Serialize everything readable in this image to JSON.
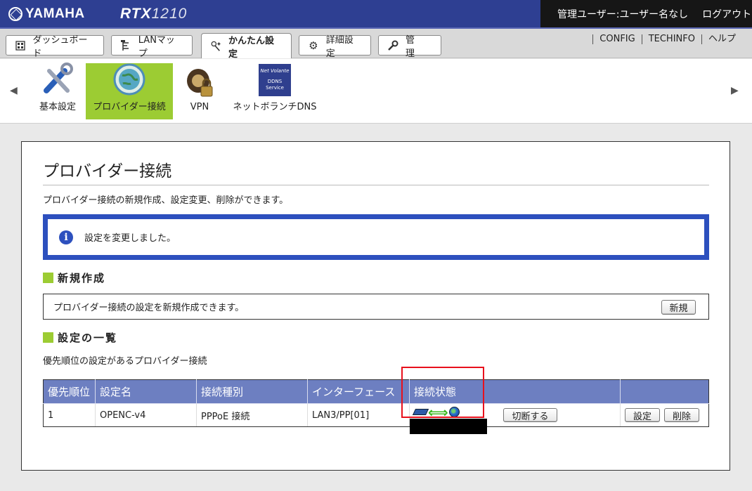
{
  "header": {
    "brand": "YAMAHA",
    "model_main": "RTX",
    "model_num": "1210",
    "user_label": "管理ユーザー:ユーザー名なし",
    "logout": "ログアウト"
  },
  "tabs": [
    {
      "label": "ダッシュボード",
      "icon": "dashboard-icon"
    },
    {
      "label": "LANマップ",
      "icon": "lan-map-icon"
    },
    {
      "label": "かんたん設定",
      "icon": "wand-icon"
    },
    {
      "label": "詳細設定",
      "icon": "gear-icon"
    },
    {
      "label": "管　理",
      "icon": "wrench-icon"
    }
  ],
  "right_links": [
    "CONFIG",
    "TECHINFO",
    "ヘルプ"
  ],
  "subnav": [
    {
      "label": "基本設定",
      "icon": "tools-icon"
    },
    {
      "label": "プロバイダー接続",
      "icon": "globe-icon"
    },
    {
      "label": "VPN",
      "icon": "vpn-icon"
    },
    {
      "label": "ネットボランチDNS",
      "icon": "ddns-icon",
      "icon_text": [
        "Net Volante",
        "DDNS",
        "Service"
      ]
    }
  ],
  "page": {
    "title": "プロバイダー接続",
    "description": "プロバイダー接続の新規作成、設定変更、削除ができます。",
    "notice": "設定を変更しました。",
    "new_section_title": "新規作成",
    "new_section_text": "プロバイダー接続の設定を新規作成できます。",
    "new_button": "新規",
    "list_section_title": "設定の一覧",
    "list_desc": "優先順位の設定があるプロバイダー接続"
  },
  "table": {
    "headers": [
      "優先順位",
      "設定名",
      "接続種別",
      "インターフェース",
      "接続状態",
      ""
    ],
    "rows": [
      {
        "priority": "1",
        "name": "OPENC-v4",
        "type": "PPPoE 接続",
        "interface": "LAN3/PP[01]",
        "disconnect_button": "切断する",
        "edit_button": "設定",
        "delete_button": "削除"
      }
    ]
  },
  "colors": {
    "header_bg": "#2e3f92",
    "accent_green": "#9ccc33",
    "notice_border": "#2d50be",
    "table_header": "#6d7fc1",
    "highlight_red": "#e8101c"
  }
}
